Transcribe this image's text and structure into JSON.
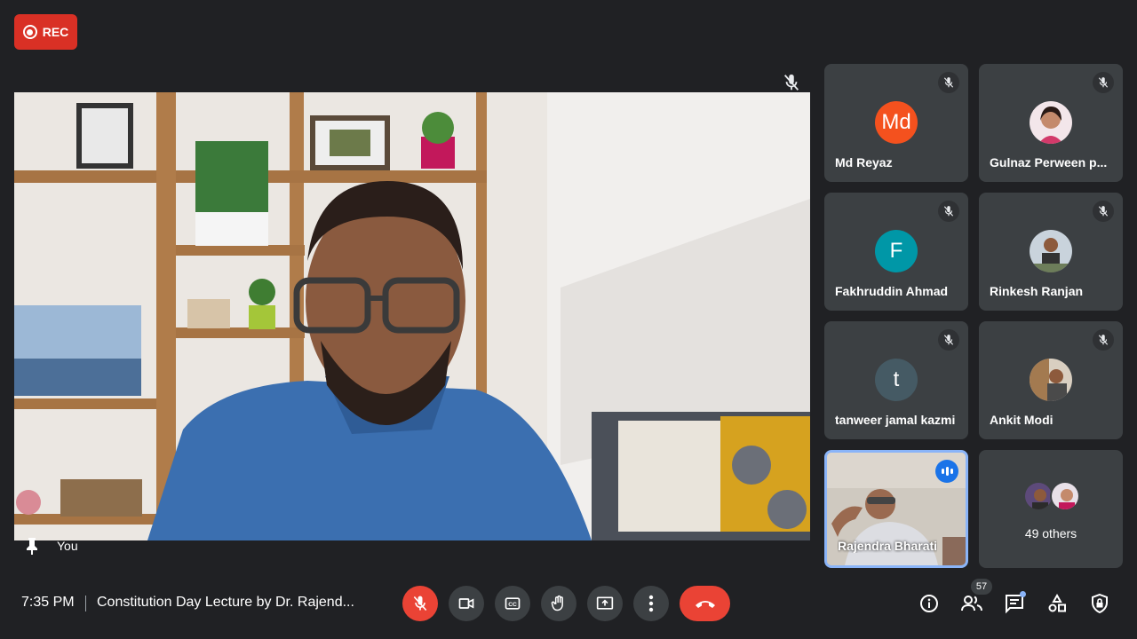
{
  "recording": {
    "label": "REC",
    "color": "#d93025"
  },
  "main_video": {
    "label": "You",
    "muted_icon": "mic-off-icon",
    "pin_icon": "pin-icon"
  },
  "participants": [
    {
      "name": "Md Reyaz",
      "initials": "Md",
      "avatar_color": "#f4511e",
      "muted": true
    },
    {
      "name": "Gulnaz Perween p...",
      "initials": "",
      "muted": true
    },
    {
      "name": "Fakhruddin Ahmad",
      "initials": "F",
      "avatar_color": "#0097a7",
      "muted": true
    },
    {
      "name": "Rinkesh Ranjan",
      "initials": "",
      "muted": true
    },
    {
      "name": "tanweer jamal kazmi",
      "initials": "t",
      "avatar_color": "#455a64",
      "muted": true
    },
    {
      "name": "Ankit Modi",
      "initials": "",
      "muted": true
    },
    {
      "name": "Rajendra Bharati",
      "initials": "",
      "speaking": true
    }
  ],
  "others": {
    "label": "49 others"
  },
  "bottom_bar": {
    "time": "7:35 PM",
    "meeting_title": "Constitution Day Lecture by Dr. Rajend...",
    "participant_count": "57",
    "controls": [
      "mic-off-icon",
      "camera-icon",
      "captions-icon",
      "raise-hand-icon",
      "present-icon",
      "more-options-icon",
      "end-call-icon"
    ],
    "right_icons": [
      "info-icon",
      "people-icon",
      "chat-icon",
      "activities-icon",
      "host-controls-icon"
    ]
  },
  "colors": {
    "background": "#202124",
    "tile": "#3c4043",
    "danger": "#ea4335",
    "accent": "#8ab4f8"
  }
}
